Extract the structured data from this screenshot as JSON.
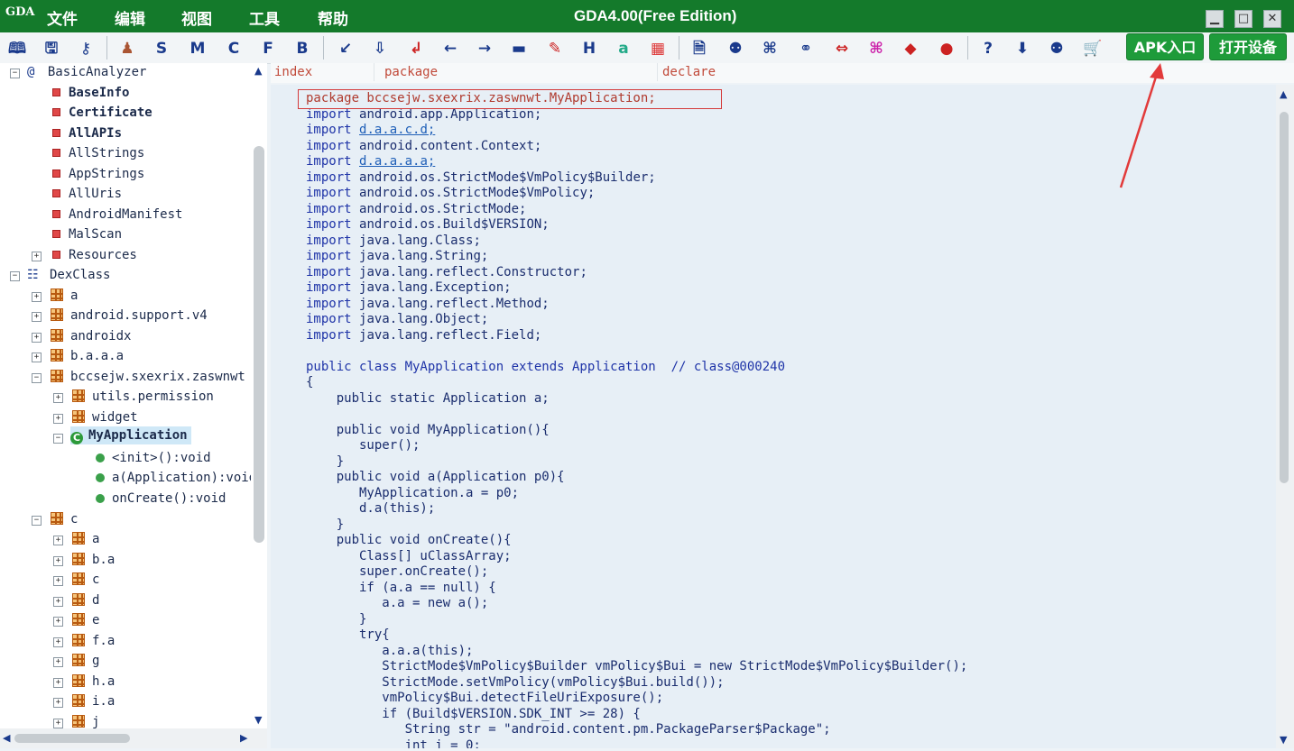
{
  "app": {
    "logo_text": "GDA",
    "title": "GDA4.00(Free Edition)",
    "menu": [
      "文件",
      "编辑",
      "视图",
      "工具",
      "帮助"
    ]
  },
  "window_controls": {
    "minimize": "▁",
    "maximize": "□",
    "close": "✕"
  },
  "toolbar": {
    "letters": [
      "S",
      "M",
      "C",
      "F",
      "B",
      "H"
    ],
    "apk_button": "APK入口",
    "device_button": "打开设备"
  },
  "tree": {
    "basic_analyzer": "BasicAnalyzer",
    "basic_items": [
      "BaseInfo",
      "Certificate",
      "AllAPIs",
      "AllStrings",
      "AppStrings",
      "AllUris",
      "AndroidManifest",
      "MalScan",
      "Resources"
    ],
    "dexclass": "DexClass",
    "packages_top": [
      "a",
      "android.support.v4",
      "androidx",
      "b.a.a.a",
      "bccsejw.sxexrix.zaswnwt"
    ],
    "sub_packages": [
      "utils.permission",
      "widget"
    ],
    "selected_class": "MyApplication",
    "methods": [
      "<init>():void",
      "a(Application):void",
      "onCreate():void"
    ],
    "package_c": "c",
    "c_children": [
      "a",
      "b.a",
      "c",
      "d",
      "e",
      "f.a",
      "g",
      "h.a",
      "i.a",
      "j"
    ]
  },
  "columns": {
    "index": "index",
    "package": "package",
    "declare": "declare"
  },
  "code": {
    "package_line": "package bccsejw.sxexrix.zaswnwt.MyApplication;",
    "imports": [
      "android.app.Application;",
      "d.a.a.c.d;",
      "android.content.Context;",
      "d.a.a.a.a;",
      "android.os.StrictMode$VmPolicy$Builder;",
      "android.os.StrictMode$VmPolicy;",
      "android.os.StrictMode;",
      "android.os.Build$VERSION;",
      "java.lang.Class;",
      "java.lang.String;",
      "java.lang.reflect.Constructor;",
      "java.lang.Exception;",
      "java.lang.reflect.Method;",
      "java.lang.Object;",
      "java.lang.reflect.Field;"
    ],
    "import_kw": "import",
    "class_decl": "public class MyApplication extends Application  // class@000240",
    "body": [
      "{",
      "    public static Application a;",
      "",
      "    public void MyApplication(){",
      "       super();",
      "    }",
      "    public void a(Application p0){",
      "       MyApplication.a = p0;",
      "       d.a(this);",
      "    }",
      "    public void onCreate(){",
      "       Class[] uClassArray;",
      "       super.onCreate();",
      "       if (a.a == null) {",
      "          a.a = new a();",
      "       }",
      "       try{",
      "          a.a.a(this);",
      "          StrictMode$VmPolicy$Builder vmPolicy$Bui = new StrictMode$VmPolicy$Builder();",
      "          StrictMode.setVmPolicy(vmPolicy$Bui.build());",
      "          vmPolicy$Bui.detectFileUriExposure();",
      "          if (Build$VERSION.SDK_INT >= 28) {",
      "             String str = \"android.content.pm.PackageParser$Package\";",
      "             int i = 0;"
    ]
  },
  "colors": {
    "titlebar": "#147a2b",
    "button_green": "#1e9b3a",
    "highlight_red": "#d43a3a"
  }
}
